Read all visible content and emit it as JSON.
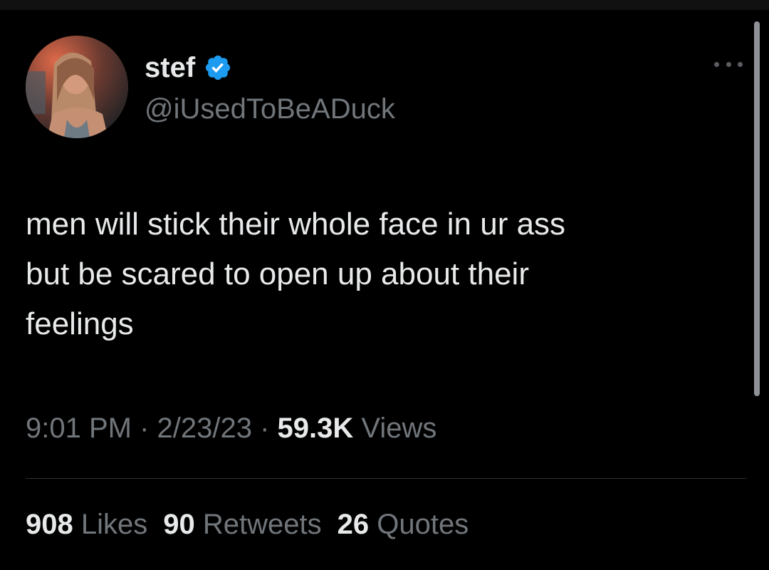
{
  "author": {
    "display_name": "stef",
    "handle": "@iUsedToBeADuck",
    "verified": true,
    "avatar_icon": "profile-photo",
    "verified_icon": "verified-badge-icon",
    "verified_color": "#1d9bf0"
  },
  "menu_icon": "more-options-icon",
  "tweet": {
    "text": "men will stick their whole face in ur ass\nbut be scared to open up about their\nfeelings"
  },
  "meta": {
    "time": "9:01 PM",
    "sep1": " · ",
    "date": "2/23/23",
    "sep2": " · ",
    "views_count": "59.3K",
    "views_label": " Views"
  },
  "stats": {
    "likes_count": "908",
    "likes_label": " Likes",
    "retweets_count": "90",
    "retweets_label": " Retweets",
    "quotes_count": "26",
    "quotes_label": " Quotes"
  },
  "colors": {
    "background": "#000000",
    "primary_text": "#e7e9ea",
    "secondary_text": "#71767b",
    "divider": "#2f3336"
  }
}
